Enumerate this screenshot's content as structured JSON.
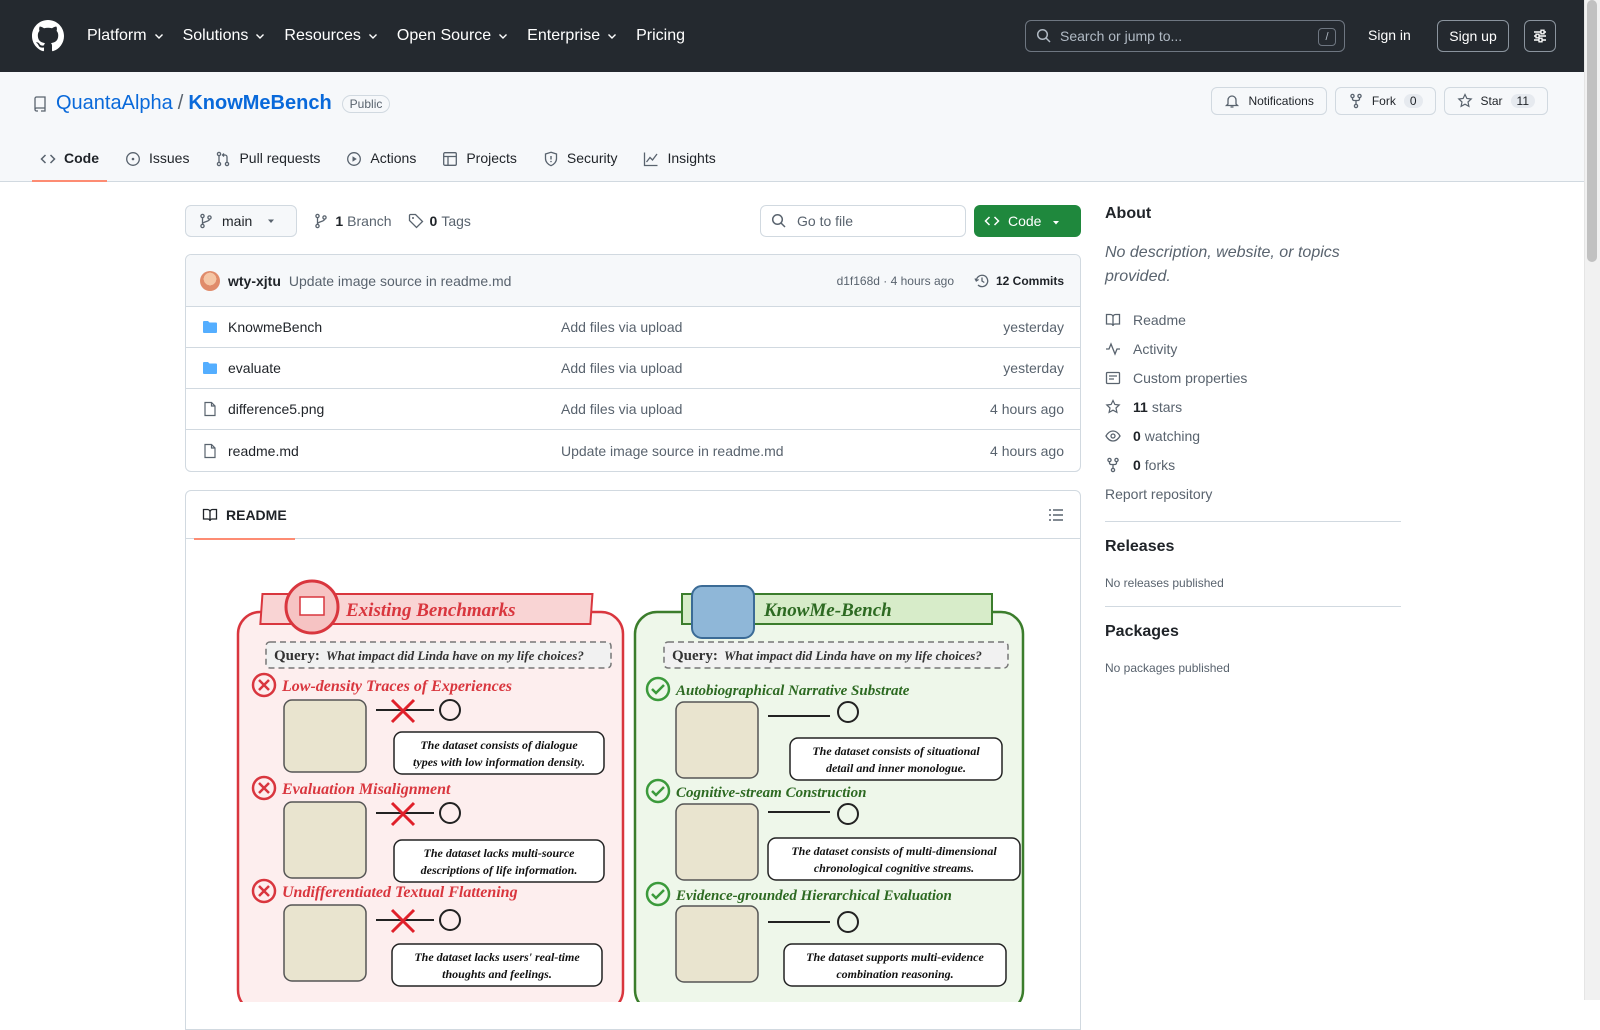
{
  "header": {
    "nav": [
      {
        "label": "Platform"
      },
      {
        "label": "Solutions"
      },
      {
        "label": "Resources"
      },
      {
        "label": "Open Source"
      },
      {
        "label": "Enterprise"
      },
      {
        "label": "Pricing"
      }
    ],
    "search_placeholder": "Search or jump to...",
    "search_shortcut": "/",
    "sign_in": "Sign in",
    "sign_up": "Sign up"
  },
  "repo": {
    "owner": "QuantaAlpha",
    "separator": "/",
    "name": "KnowMeBench",
    "visibility": "Public",
    "notifications_label": "Notifications",
    "fork_label": "Fork",
    "fork_count": "0",
    "star_label": "Star",
    "star_count": "11",
    "tabs": [
      {
        "label": "Code",
        "icon": "code-icon"
      },
      {
        "label": "Issues",
        "icon": "issue-icon"
      },
      {
        "label": "Pull requests",
        "icon": "pull-request-icon"
      },
      {
        "label": "Actions",
        "icon": "play-icon"
      },
      {
        "label": "Projects",
        "icon": "table-icon"
      },
      {
        "label": "Security",
        "icon": "shield-icon"
      },
      {
        "label": "Insights",
        "icon": "graph-icon"
      }
    ]
  },
  "toolbar": {
    "branch": "main",
    "branch_count": "1",
    "branch_word": "Branch",
    "tag_count": "0",
    "tag_word": "Tags",
    "goto_placeholder": "Go to file",
    "code_button": "Code"
  },
  "commit": {
    "author": "wty-xjtu",
    "message": "Update image source in readme.md",
    "meta": "d1f168d · 4 hours ago",
    "commits": "12 Commits"
  },
  "files": [
    {
      "name": "KnowmeBench",
      "type": "folder",
      "message": "Add files via upload",
      "age": "yesterday"
    },
    {
      "name": "evaluate",
      "type": "folder",
      "message": "Add files via upload",
      "age": "yesterday"
    },
    {
      "name": "difference5.png",
      "type": "file",
      "message": "Add files via upload",
      "age": "4 hours ago"
    },
    {
      "name": "readme.md",
      "type": "file",
      "message": "Update image source in readme.md",
      "age": "4 hours ago"
    }
  ],
  "readme": {
    "tab_label": "README",
    "figure": {
      "left_title": "Existing Benchmarks",
      "right_title": "KnowMe-Bench",
      "query_prefix": "Query:",
      "query_text": "What impact did Linda have on my life choices?",
      "left_items": [
        {
          "heading": "Low-density Traces of Experiences",
          "note_1": "The dataset consists of dialogue",
          "note_2": "types with low information density."
        },
        {
          "heading": "Evaluation Misalignment",
          "note_1": "The dataset lacks multi-source",
          "note_2": "descriptions of life information."
        },
        {
          "heading": "Undifferentiated Textual Flattening",
          "note_1": "The dataset lacks users' real-time",
          "note_2": "thoughts and feelings."
        }
      ],
      "right_items": [
        {
          "heading": "Autobiographical Narrative Substrate",
          "note_1": "The dataset consists of situational",
          "note_2": "detail and inner monologue."
        },
        {
          "heading": "Cognitive-stream Construction",
          "note_1": "The dataset consists of multi-dimensional",
          "note_2": "chronological cognitive streams."
        },
        {
          "heading": "Evidence-grounded Hierarchical Evaluation",
          "note_1": "The dataset supports multi-evidence",
          "note_2": "combination reasoning."
        }
      ]
    }
  },
  "about": {
    "title": "About",
    "description": "No description, website, or topics provided.",
    "readme": "Readme",
    "activity": "Activity",
    "custom_properties": "Custom properties",
    "stars_count": "11",
    "stars_word": "stars",
    "watching_count": "0",
    "watching_word": "watching",
    "forks_count": "0",
    "forks_word": "forks",
    "report": "Report repository"
  },
  "releases": {
    "title": "Releases",
    "empty": "No releases published"
  },
  "packages": {
    "title": "Packages",
    "empty": "No packages published"
  },
  "colors": {
    "header_bg": "#24292f",
    "link": "#0969da",
    "primary_button": "#1f883d",
    "tab_underline": "#fd8c73",
    "existing_red": "#d9363e",
    "knowme_green": "#3b7d2c"
  }
}
